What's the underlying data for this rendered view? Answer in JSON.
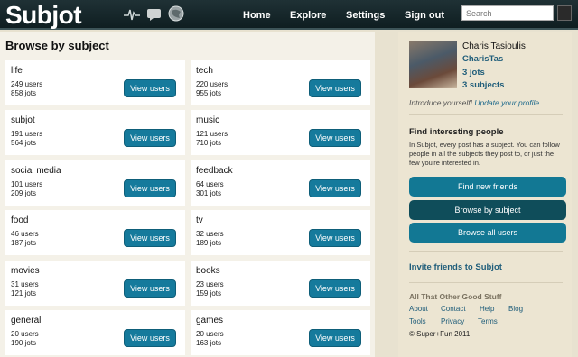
{
  "app": {
    "logo": "Subjot"
  },
  "topnav": {
    "items": [
      "Home",
      "Explore",
      "Settings",
      "Sign out"
    ],
    "search_placeholder": "Search"
  },
  "main": {
    "heading": "Browse by subject",
    "button_label": "View users",
    "subjects": [
      {
        "name": "life",
        "users": "249 users",
        "jots": "858 jots"
      },
      {
        "name": "tech",
        "users": "220 users",
        "jots": "955 jots"
      },
      {
        "name": "subjot",
        "users": "191 users",
        "jots": "564 jots"
      },
      {
        "name": "music",
        "users": "121 users",
        "jots": "710 jots"
      },
      {
        "name": "social media",
        "users": "101 users",
        "jots": "209 jots"
      },
      {
        "name": "feedback",
        "users": "64 users",
        "jots": "301 jots"
      },
      {
        "name": "food",
        "users": "46 users",
        "jots": "187 jots"
      },
      {
        "name": "tv",
        "users": "32 users",
        "jots": "189 jots"
      },
      {
        "name": "movies",
        "users": "31 users",
        "jots": "121 jots"
      },
      {
        "name": "books",
        "users": "23 users",
        "jots": "159 jots"
      },
      {
        "name": "general",
        "users": "20 users",
        "jots": "190 jots"
      },
      {
        "name": "games",
        "users": "20 users",
        "jots": "163 jots"
      }
    ]
  },
  "sidebar": {
    "profile": {
      "name": "Charis Tasioulis",
      "username": "CharisTas",
      "jots": "3 jots",
      "subjects": "3 subjects"
    },
    "intro_text": "Introduce yourself!",
    "intro_link": "Update your profile.",
    "find_title": "Find interesting people",
    "find_desc": "In Subjot, every post has a subject. You can follow people in all the subjects they post to, or just the few you're interested in.",
    "buttons": {
      "find_new": "Find new friends",
      "browse_subject": "Browse by subject",
      "browse_all": "Browse all users"
    },
    "invite": "Invite friends to Subjot",
    "other_title": "All That Other Good Stuff",
    "footer_links": [
      "About",
      "Contact",
      "Help",
      "Blog",
      "Tools",
      "Privacy",
      "Terms"
    ],
    "copyright": "© Super+Fun 2011"
  },
  "colors": {
    "topbar": "#0f1e21",
    "button": "#157a9c",
    "active_button": "#0f4d5a",
    "link": "#1f5d7a"
  }
}
